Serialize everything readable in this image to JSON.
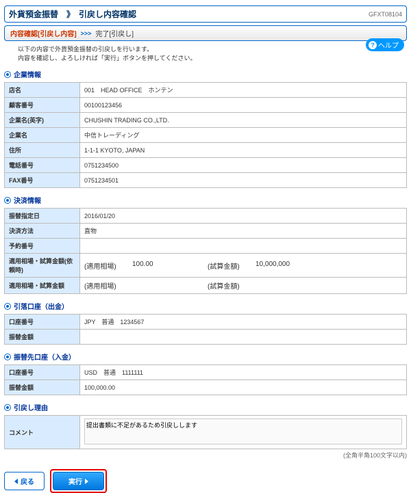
{
  "header": {
    "title": "外貨預金振替　》　引戻し内容確認",
    "code": "GFXT08104"
  },
  "breadcrumb": {
    "current": "内容確認[引戻し内容]",
    "arrow": ">>>",
    "next": "完了[引戻し]"
  },
  "lead": "以下の内容で外貨預金振替の引戻しを行います。\n内容を確認し、よろしければ「実行」ボタンを押してください。",
  "help": {
    "label": "ヘルプ"
  },
  "sections": {
    "company": {
      "title": "企業情報",
      "rows": [
        {
          "label": "店名",
          "value": "001　HEAD OFFICE　ホンテン"
        },
        {
          "label": "顧客番号",
          "value": "00100123456"
        },
        {
          "label": "企業名(英字)",
          "value": "CHUSHIN TRADING CO.,LTD."
        },
        {
          "label": "企業名",
          "value": "中信トレーディング"
        },
        {
          "label": "住所",
          "value": "1-1-1 KYOTO, JAPAN"
        },
        {
          "label": "電話番号",
          "value": "0751234500"
        },
        {
          "label": "FAX番号",
          "value": "0751234501"
        }
      ]
    },
    "settlement": {
      "title": "決済情報",
      "rows": [
        {
          "label": "振替指定日",
          "value": "2016/01/20"
        },
        {
          "label": "決済方法",
          "value": "直物"
        },
        {
          "label": "予約番号",
          "value": ""
        }
      ],
      "rate_rows": [
        {
          "label": "適用相場・試算金額(依頼時)",
          "c1label": "(適用相場)",
          "c1val": "100.00",
          "c2label": "(試算金額)",
          "c2val": "10,000,000"
        },
        {
          "label": "適用相場・試算金額",
          "c1label": "(適用相場)",
          "c1val": "",
          "c2label": "(試算金額)",
          "c2val": ""
        }
      ]
    },
    "debit": {
      "title": "引落口座（出金）",
      "rows": [
        {
          "label": "口座番号",
          "value": "JPY　普通　1234567"
        },
        {
          "label": "振替金額",
          "value": ""
        }
      ]
    },
    "credit": {
      "title": "振替先口座（入金）",
      "rows": [
        {
          "label": "口座番号",
          "value": "USD　普通　1111111"
        },
        {
          "label": "振替金額",
          "value": "100,000.00"
        }
      ]
    },
    "reason": {
      "title": "引戻し理由",
      "comment_label": "コメント",
      "comment_value": "提出書類に不足があるため引戻しします",
      "counter": "(全角半角100文字以内)"
    }
  },
  "buttons": {
    "back": "戻る",
    "exec": "実行"
  }
}
